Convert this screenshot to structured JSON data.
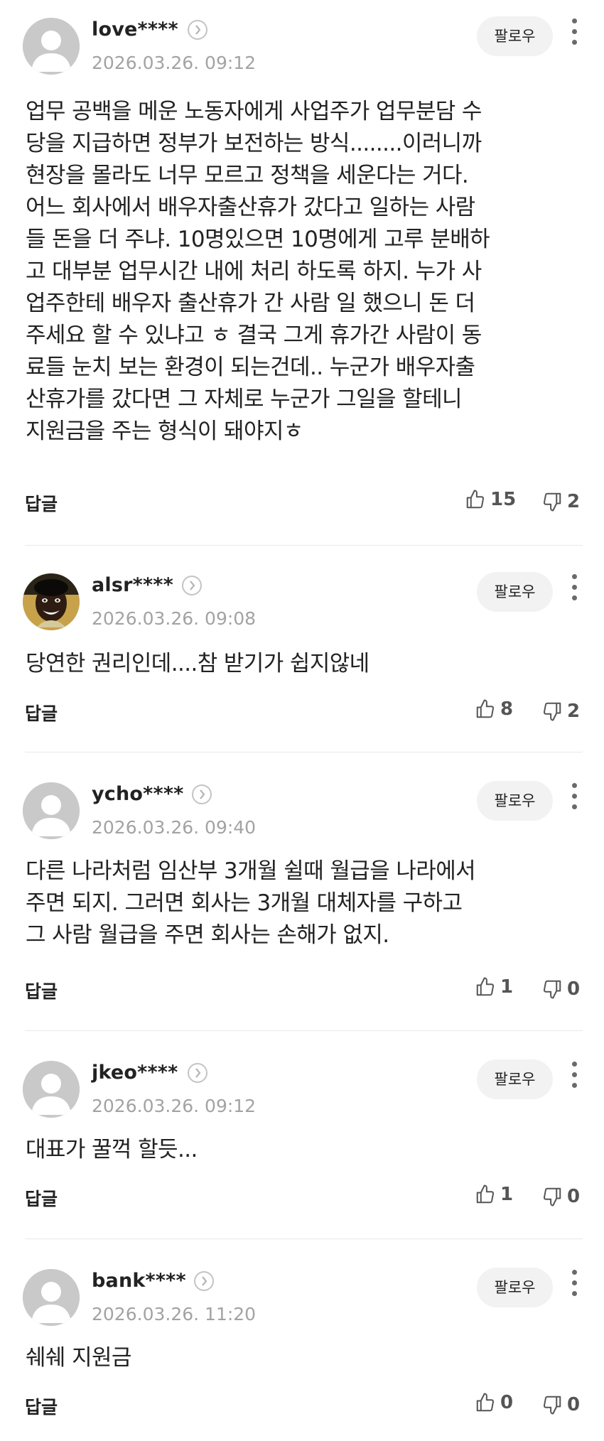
{
  "comments": [
    {
      "username": "love****",
      "timestamp": "2026.03.26. 09:12",
      "follow_label": "팔로우",
      "body_lines": [
        "업무 공백을 메운 노동자에게 사업주가 업무분담 수",
        "당을 지급하면 정부가 보전하는 방식........이러니까",
        "현장을 몰라도 너무 모르고 정책을 세운다는 거다.",
        "어느 회사에서 배우자출산휴가 갔다고 일하는 사람",
        "들 돈을 더 주냐. 10명있으면 10명에게 고루 분배하",
        "고 대부분 업무시간 내에 처리 하도록 하지. 누가 사",
        "업주한테 배우자 출산휴가 간 사람 일 했으니 돈 더",
        "주세요 할 수 있냐고 ㅎ 결국 그게 휴가간 사람이 동",
        "료들 눈치 보는 환경이 되는건데.. 누군가 배우자출",
        "산휴가를 갔다면 그 자체로 누군가 그일을 할테니",
        "지원금을 주는 형식이 돼야지ㅎ"
      ],
      "reply_label": "답글",
      "likes": "15",
      "dislikes": "2",
      "avatar": "default-avatar"
    },
    {
      "username": "alsr****",
      "timestamp": "2026.03.26. 09:08",
      "follow_label": "팔로우",
      "body_lines": [
        "당연한 권리인데....참 받기가 쉽지않네"
      ],
      "reply_label": "답글",
      "likes": "8",
      "dislikes": "2",
      "avatar": "photo-avatar"
    },
    {
      "username": "ycho****",
      "timestamp": "2026.03.26. 09:40",
      "follow_label": "팔로우",
      "body_lines": [
        "다른 나라처럼 임산부 3개월 쉴때 월급을 나라에서",
        "주면 되지. 그러면 회사는 3개월 대체자를 구하고",
        "그 사람 월급을 주면 회사는 손해가 없지."
      ],
      "reply_label": "답글",
      "likes": "1",
      "dislikes": "0",
      "avatar": "default-avatar"
    },
    {
      "username": "jkeo****",
      "timestamp": "2026.03.26. 09:12",
      "follow_label": "팔로우",
      "body_lines": [
        "대표가 꿀꺽 할듯..."
      ],
      "reply_label": "답글",
      "likes": "1",
      "dislikes": "0",
      "avatar": "default-avatar"
    },
    {
      "username": "bank****",
      "timestamp": "2026.03.26. 11:20",
      "follow_label": "팔로우",
      "body_lines": [
        "쉐쉐 지원금"
      ],
      "reply_label": "답글",
      "likes": "0",
      "dislikes": "0",
      "avatar": "default-avatar"
    }
  ],
  "colors": {
    "text": "#222222",
    "meta": "#a3a3a3",
    "follow_bg": "#f2f2f2",
    "avatar_bg": "#c9c9c9",
    "divider": "#e9e9e9"
  },
  "icons": {
    "profile": "chevron-right-circle-icon",
    "more": "more-vertical-icon",
    "like": "thumbs-up-icon",
    "dislike": "thumbs-down-icon"
  }
}
